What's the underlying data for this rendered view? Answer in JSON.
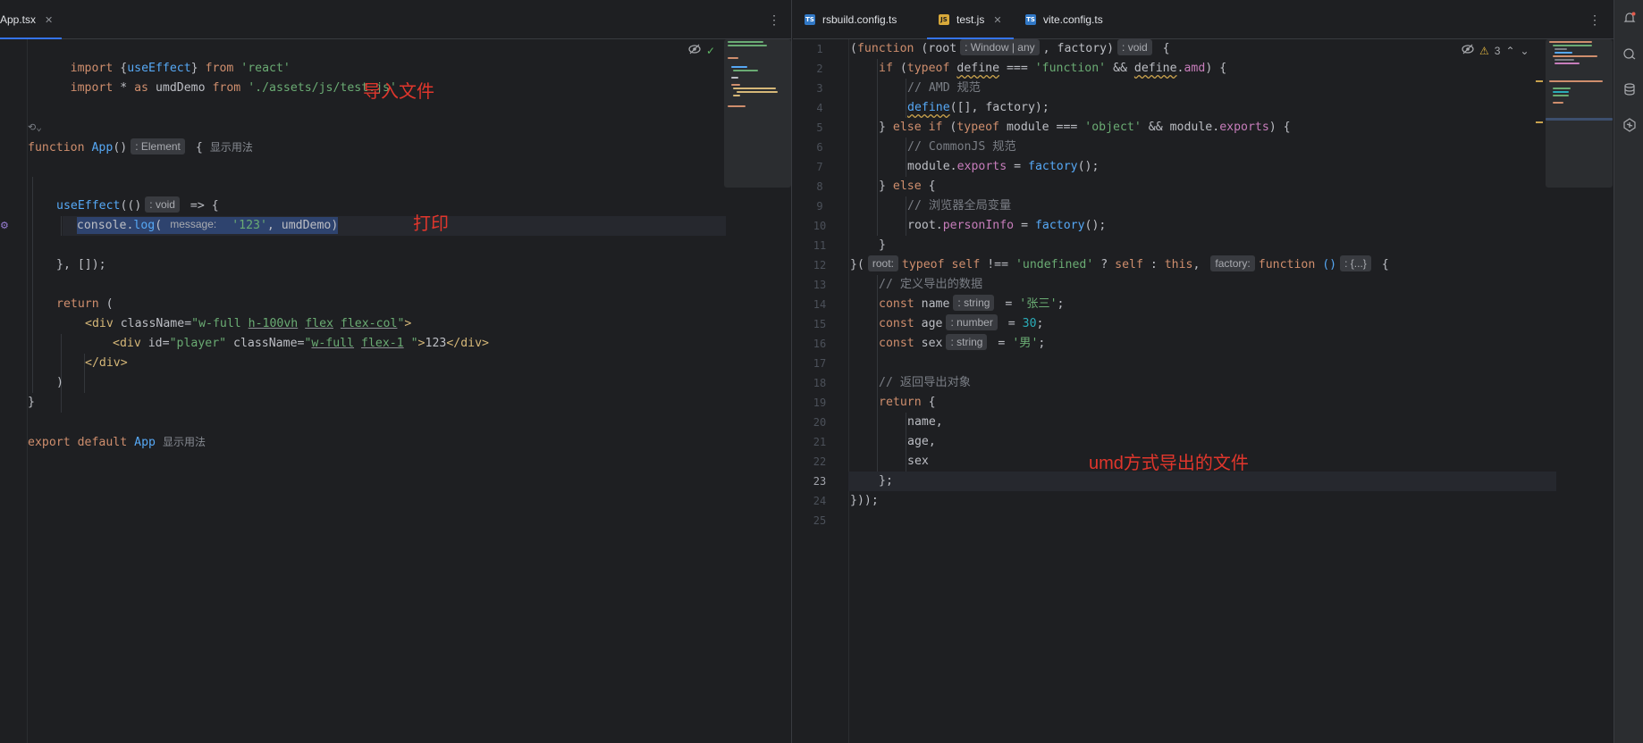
{
  "left": {
    "tab": {
      "label": "App.tsx",
      "close": "✕"
    },
    "menu": "⋮",
    "lines": [
      {
        "y": 0,
        "html": "<span class=\"kw\">import</span> <span class=\"paren\">{</span><span class=\"fn\">useEffect</span><span class=\"paren\">}</span> <span class=\"kw\">from</span> <span class=\"str\">'react'</span>"
      },
      {
        "y": 1,
        "html": "<span class=\"kw\">import</span> * <span class=\"kw\">as</span> <span class=\"var\">umdDemo</span> <span class=\"kw\">from</span> <span class=\"str\">'./assets/js/test.js'</span>"
      }
    ],
    "annotations": {
      "import": "导入文件",
      "print": "打印"
    },
    "hints": {
      "element": ": Element",
      "void": ": void",
      "message": "message:",
      "usage": "显示用法",
      "usage2": "显示用法",
      "fold": "⟲⌄"
    },
    "code": {
      "function_kw": "function",
      "app_name": "App",
      "paren_open_close": "()",
      "brace": "{",
      "use_effect": "useEffect",
      "arrow_paren": "(()",
      "arrow": " => {",
      "console": "console",
      "log": "log",
      "str_123": "'123'",
      "umd_demo": "umdDemo",
      "end_effect": "}, []);",
      "return_kw": "return",
      "return_paren": " (",
      "div_open_1": "<div",
      "class_name": "className",
      "class_val_1a": "\"w-full ",
      "class_val_1b": "h-100vh",
      "class_val_1c": "flex",
      "class_val_1d": "flex-col",
      "class_val_1e": "\"",
      "div_close_bracket": ">",
      "div_open_2": "<div",
      "id_attr": "id",
      "id_val": "\"player\"",
      "class_val_2a": "\"",
      "class_val_2b": "w-full",
      "class_val_2c": "flex-1",
      "class_val_2d": " \"",
      "text_123": "123",
      "div_end": "</div>",
      "div_end_outer": "</div>",
      "close_paren": ")",
      "close_brace": "}",
      "export_kw": "export",
      "default_kw": "default",
      "app_ref": "App"
    }
  },
  "right": {
    "tabs": [
      {
        "label": "rsbuild.config.ts",
        "type": "TS"
      },
      {
        "label": "test.js",
        "type": "JS",
        "close": "✕"
      },
      {
        "label": "vite.config.ts",
        "type": "TS"
      }
    ],
    "menu": "⋮",
    "warnings": "3",
    "line_numbers": [
      "1",
      "2",
      "3",
      "4",
      "5",
      "6",
      "7",
      "8",
      "9",
      "10",
      "11",
      "12",
      "13",
      "14",
      "15",
      "16",
      "17",
      "18",
      "19",
      "20",
      "21",
      "22",
      "23",
      "24",
      "25"
    ],
    "hints": {
      "root_type": ": Window | any",
      "void": ": void",
      "root": "root:",
      "factory": "factory:",
      "obj": ": {...}",
      "string1": ": string",
      "number": ": number",
      "string2": ": string"
    },
    "code": {
      "l1a": "(",
      "l1b": "function",
      "l1c": " (",
      "l1d": "root",
      "l1e": ", ",
      "l1f": "factory",
      "l1g": ")",
      "l1h": " {",
      "l2a": "if",
      "l2b": " (",
      "l2c": "typeof",
      "l2d": "define",
      "l2e": " === ",
      "l2f": "'function'",
      "l2g": " && ",
      "l2h": "define",
      "l2i": ".",
      "l2j": "amd",
      "l2k": ") {",
      "l3": "// AMD 规范",
      "l4a": "define",
      "l4b": "([], ",
      "l4c": "factory",
      "l4d": ");",
      "l5a": "} ",
      "l5b": "else if",
      "l5c": " (",
      "l5d": "typeof",
      "l5e": "module",
      "l5f": " === ",
      "l5g": "'object'",
      "l5h": " && ",
      "l5i": "module",
      "l5j": ".",
      "l5k": "exports",
      "l5l": ") {",
      "l6": "// CommonJS 规范",
      "l7a": "module",
      "l7b": ".",
      "l7c": "exports",
      "l7d": " = ",
      "l7e": "factory",
      "l7f": "();",
      "l8a": "} ",
      "l8b": "else",
      "l8c": " {",
      "l9": "// 浏览器全局变量",
      "l10a": "root",
      "l10b": ".",
      "l10c": "personInfo",
      "l10d": " = ",
      "l10e": "factory",
      "l10f": "();",
      "l11": "}",
      "l12a": "}(",
      "l12b": "typeof",
      "l12c": "self",
      "l12d": " !== ",
      "l12e": "'undefined'",
      "l12f": " ? ",
      "l12g": "self",
      "l12h": " : ",
      "l12i": "this",
      "l12j": ", ",
      "l12k": "function",
      "l12l": " ()",
      "l12m": " {",
      "l13": "// 定义导出的数据",
      "l14a": "const",
      "l14b": " name",
      "l14c": " = ",
      "l14d": "'张三'",
      "l14e": ";",
      "l15a": "const",
      "l15b": " age",
      "l15c": " = ",
      "l15d": "30",
      "l15e": ";",
      "l16a": "const",
      "l16b": " sex",
      "l16c": " = ",
      "l16d": "'男'",
      "l16e": ";",
      "l18": "// 返回导出对象",
      "l19a": "return",
      "l19b": " {",
      "l20": "name,",
      "l21": "age,",
      "l22": "sex",
      "l23": "};",
      "l24": "}));"
    },
    "annotation": "umd方式导出的文件"
  }
}
